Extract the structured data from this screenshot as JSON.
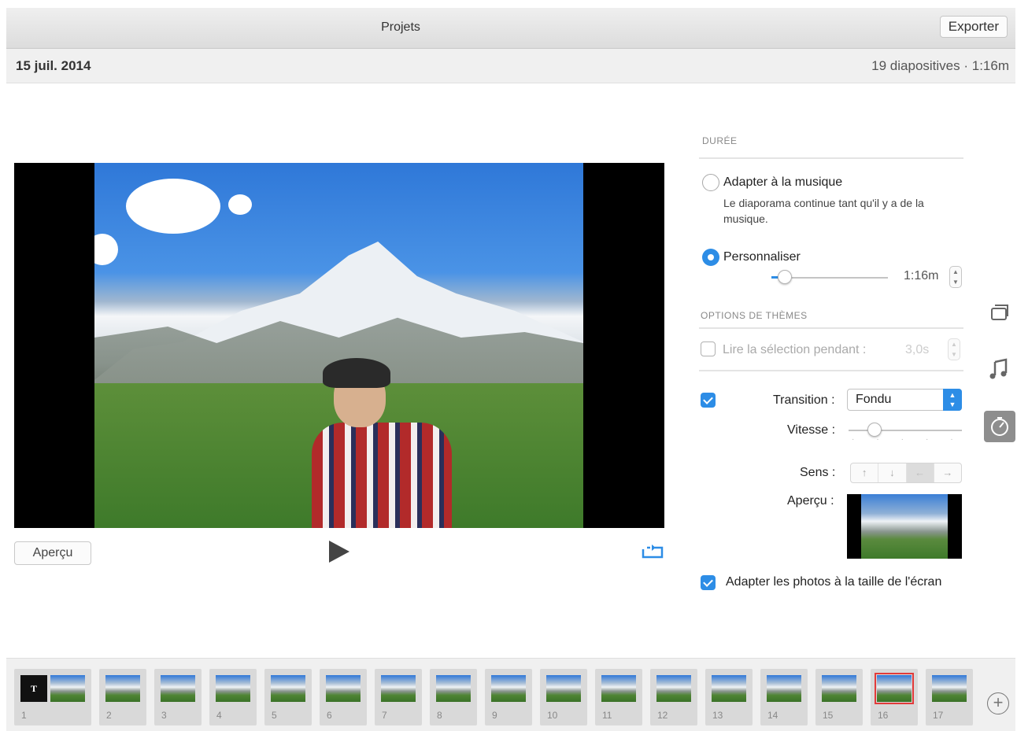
{
  "toolbar": {
    "title": "Projets",
    "export_label": "Exporter"
  },
  "info": {
    "date": "15 juil. 2014",
    "summary": "19 diapositives · 1:16m"
  },
  "viewer": {
    "preview_label": "Aperçu",
    "play_icon": "play-icon",
    "loop_icon": "loop-icon"
  },
  "panel": {
    "duration": {
      "title": "DURÉE",
      "fit_music_label": "Adapter à la musique",
      "fit_music_desc": "Le diaporama continue tant qu'il y a de la musique.",
      "custom_label": "Personnaliser",
      "custom_value": "1:16m",
      "selected": "custom",
      "slider_level": 0.12
    },
    "theme_options": {
      "title": "OPTIONS DE THÈMES",
      "play_selection_label": "Lire la sélection pendant :",
      "play_selection_value": "3,0s",
      "play_selection_checked": false,
      "transition_checked": true,
      "transition_label": "Transition :",
      "transition_value": "Fondu",
      "speed_label": "Vitesse :",
      "speed_level": 0.2,
      "direction_label": "Sens :",
      "directions": [
        "↑",
        "↓",
        "←",
        "→"
      ],
      "selected_direction": "←",
      "preview_label": "Aperçu :",
      "fit_photos_label": "Adapter les photos à la taille de l'écran",
      "fit_photos_checked": true
    }
  },
  "side_tools": [
    "theme-icon",
    "music-icon",
    "timer-icon"
  ],
  "filmstrip": {
    "slides": [
      "1",
      "2",
      "3",
      "4",
      "5",
      "6",
      "7",
      "8",
      "9",
      "10",
      "11",
      "12",
      "13",
      "14",
      "15",
      "16",
      "17"
    ],
    "selected": "16",
    "title_glyph": "T",
    "add_label": "+"
  },
  "colors": {
    "accent": "#2d8de6",
    "selection": "#e23b3b"
  }
}
